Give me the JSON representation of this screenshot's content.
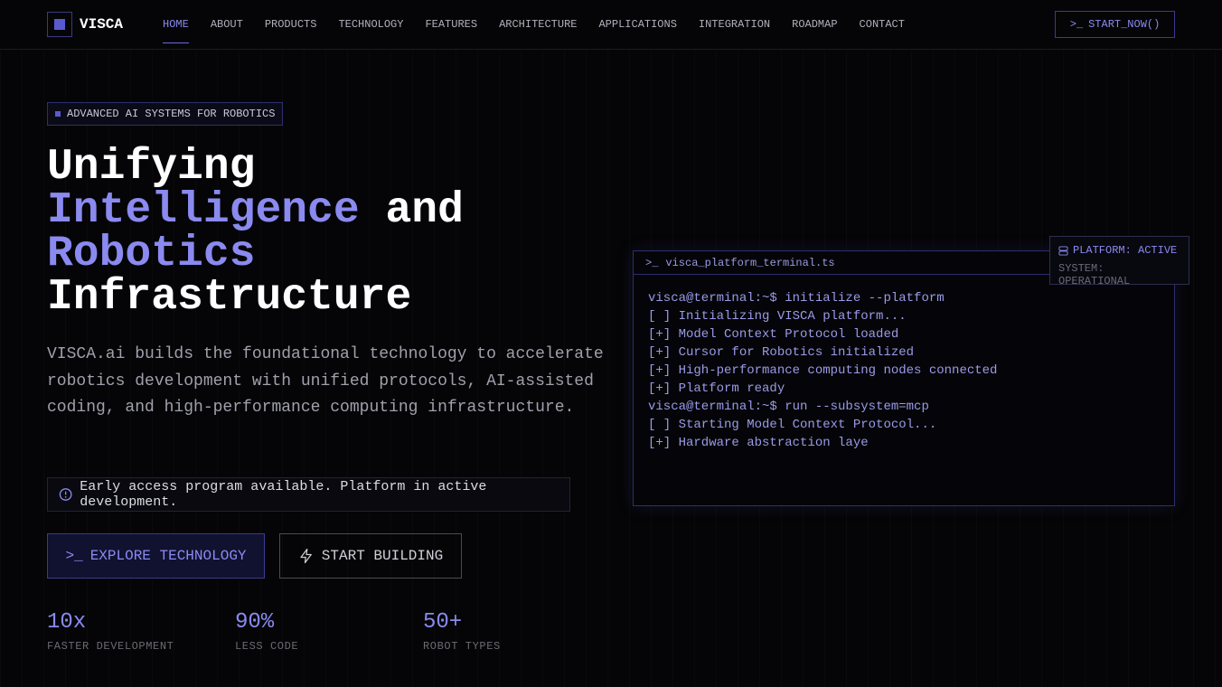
{
  "brand": {
    "name": "VISCA"
  },
  "nav": {
    "items": [
      "HOME",
      "ABOUT",
      "PRODUCTS",
      "TECHNOLOGY",
      "FEATURES",
      "ARCHITECTURE",
      "APPLICATIONS",
      "INTEGRATION",
      "ROADMAP",
      "CONTACT"
    ],
    "active": "HOME",
    "cta": "START_NOW()"
  },
  "hero": {
    "badge": "ADVANCED AI SYSTEMS FOR ROBOTICS",
    "title": {
      "w1": "Unifying",
      "w2": "Intelligence",
      "w3": "and",
      "w4": "Robotics",
      "w5": "Infrastructure"
    },
    "lead": "VISCA.ai builds the foundational technology to accelerate robotics development with unified protocols, AI-assisted coding, and high-performance computing infrastructure.",
    "notice": "Early access program available. Platform in active development.",
    "primary_button": "EXPLORE TECHNOLOGY",
    "secondary_button": "START BUILDING",
    "stats": [
      {
        "value": "10x",
        "label": "FASTER DEVELOPMENT"
      },
      {
        "value": "90%",
        "label": "LESS CODE"
      },
      {
        "value": "50+",
        "label": "ROBOT TYPES"
      }
    ]
  },
  "terminal": {
    "filename": "visca_platform_terminal.ts",
    "lines": [
      "visca@terminal:~$ initialize --platform",
      "[ ] Initializing VISCA platform...",
      "[+] Model Context Protocol loaded",
      "[+] Cursor for Robotics initialized",
      "[+] High-performance computing nodes connected",
      "[+] Platform ready",
      "visca@terminal:~$ run --subsystem=mcp",
      "[ ] Starting Model Context Protocol...",
      "[+] Hardware abstraction laye"
    ]
  },
  "status": {
    "platform": "PLATFORM: ACTIVE",
    "system": "SYSTEM: OPERATIONAL"
  }
}
